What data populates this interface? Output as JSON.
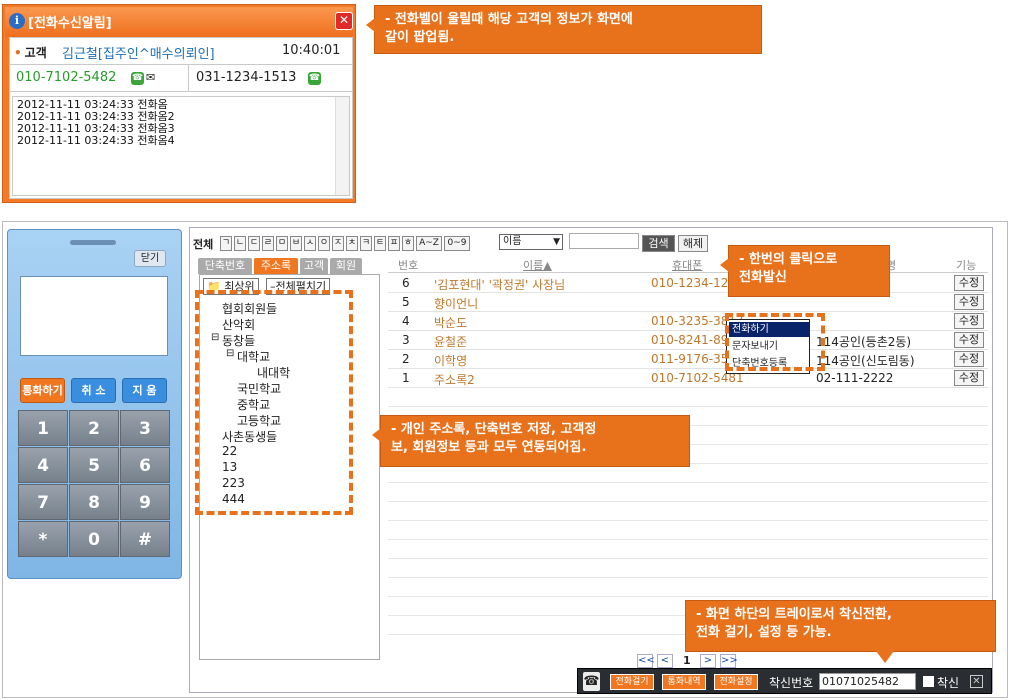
{
  "popup": {
    "title": "[전화수신알림]",
    "close": "✕",
    "customer_label": "고객",
    "customer_name": "김근철[집주인^매수의뢰인]",
    "time": "10:40:01",
    "phone_mobile": "010-7102-5482",
    "phone_office": "031-1234-1513",
    "log": [
      "2012-11-11 03:24:33 전화옴",
      "2012-11-11 03:24:33 전화옴2",
      "2012-11-11 03:24:33 전화옴3",
      "2012-11-11 03:24:33 전화옴4"
    ]
  },
  "callouts": {
    "popup_note": [
      "- 전화벨이 울릴때 해당 고객의 정보가 화면에",
      "같이 팝업됨."
    ],
    "click_note": [
      "- 한번의 클릭으로",
      "전화발신"
    ],
    "addr_note": [
      "- 개인 주소록, 단축번호 저장, 고객정",
      "보, 회원정보 등과 모두 연동되어짐."
    ],
    "tray_note": [
      "- 화면 하단의 트레이로서 착신전환,",
      "전화 걸기, 설정 등 가능."
    ]
  },
  "phone": {
    "close": "닫기",
    "call": "통화하기",
    "cancel": "취 소",
    "delete": "지 움",
    "keys": [
      "1",
      "2",
      "3",
      "4",
      "5",
      "6",
      "7",
      "8",
      "9",
      "*",
      "0",
      "#"
    ]
  },
  "toolbar": {
    "all": "전체",
    "consonants": [
      "ㄱ",
      "ㄴ",
      "ㄷ",
      "ㄹ",
      "ㅁ",
      "ㅂ",
      "ㅅ",
      "ㅇ",
      "ㅈ",
      "ㅊ",
      "ㅋ",
      "ㅌ",
      "ㅍ",
      "ㅎ",
      "A~Z",
      "0~9"
    ],
    "select_value": "이름",
    "search": "검색",
    "reset": "해제"
  },
  "tabs": [
    "단축번호",
    "주소록",
    "고객",
    "회원"
  ],
  "tree": {
    "top_btn": "최상위",
    "expand_btn": "–전체펼치기",
    "items": [
      "협회회원들",
      "산악회",
      "동창들",
      "대학교",
      "내대학",
      "국민학교",
      "중학교",
      "고등학교",
      "사촌동생들",
      "22",
      "13",
      "223",
      "444"
    ]
  },
  "table": {
    "headers": {
      "no": "번호",
      "name": "이름▲",
      "mobile": "휴대폰",
      "extra": "명",
      "action": "기능"
    },
    "rows": [
      {
        "no": "6",
        "name": "'김포현대' '곽정권' 사장님",
        "mobile": "010-1234-1234",
        "extra": "",
        "edit": "수정"
      },
      {
        "no": "5",
        "name": "향이언니",
        "mobile": "",
        "extra": "",
        "edit": "수정"
      },
      {
        "no": "4",
        "name": "박순도",
        "mobile": "010-3235-3817",
        "extra": "",
        "edit": "수정"
      },
      {
        "no": "3",
        "name": "윤철준",
        "mobile": "010-8241-8949",
        "extra": "114공인(등촌2동)",
        "edit": "수정"
      },
      {
        "no": "2",
        "name": "이학영",
        "mobile": "011-9176-3510",
        "extra": "114공인(신도림동)",
        "edit": "수정"
      },
      {
        "no": "1",
        "name": "주소록2",
        "mobile": "010-7102-5481",
        "extra": "02-111-2222",
        "edit": "수정"
      }
    ]
  },
  "context_menu": [
    "전화하기",
    "문자보내기",
    "단축번호등록"
  ],
  "pager": {
    "first": "<<",
    "prev": "<",
    "page": "1",
    "next": ">",
    "last": ">>"
  },
  "tray": {
    "call_btn": "전화걸기",
    "history_btn": "통화내역",
    "settings_btn": "전화설정",
    "forward_label": "착신번호",
    "forward_number": "01071025482",
    "forward_check": "착신",
    "close": "✕"
  },
  "colors": {
    "accent": "#e8711b",
    "link": "#1f6fb5",
    "name": "#c0772b"
  }
}
